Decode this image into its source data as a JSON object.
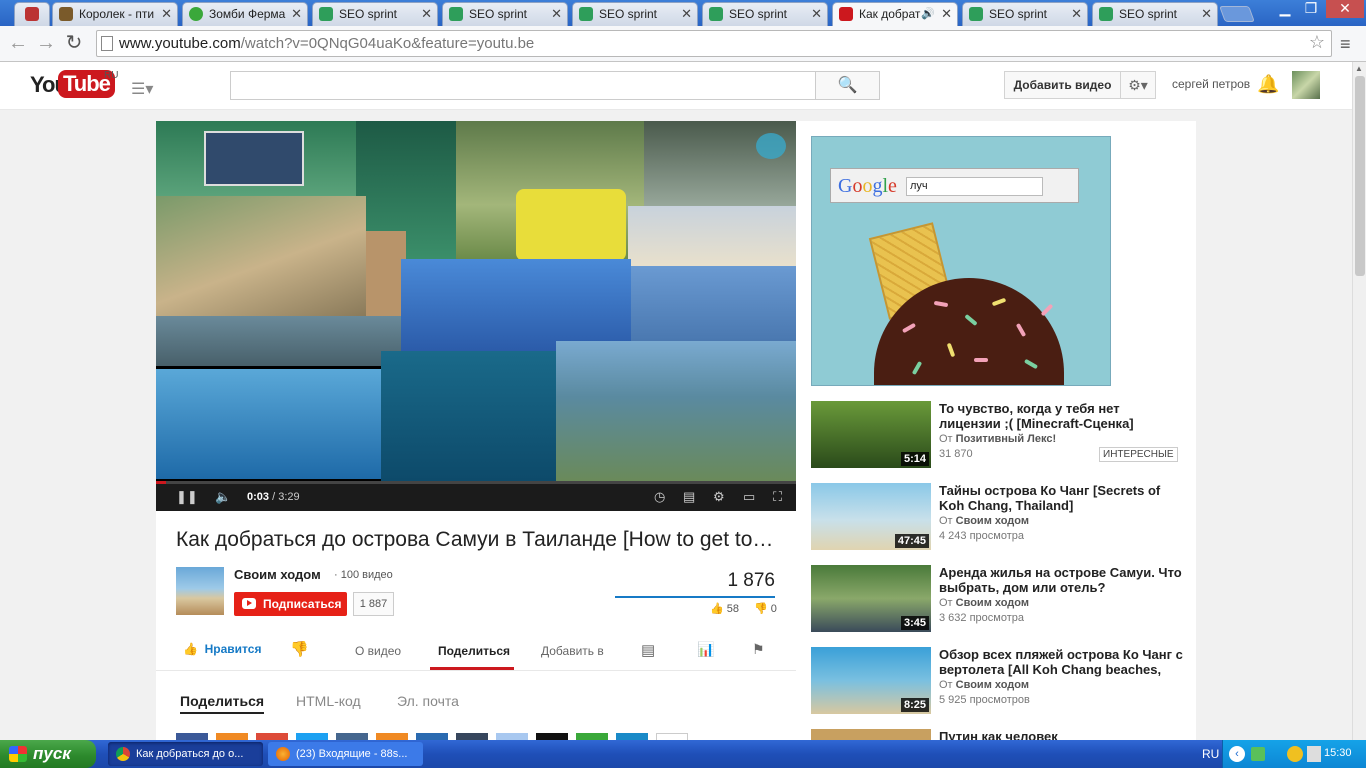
{
  "browser": {
    "tabs": [
      {
        "label": "Королек - пти",
        "color": "#7a5a2a"
      },
      {
        "label": "Зомби Ферма",
        "color": "#3aa83a"
      },
      {
        "label": "SEO sprint",
        "color": "#2e9e5a"
      },
      {
        "label": "SEO sprint",
        "color": "#2e9e5a"
      },
      {
        "label": "SEO sprint",
        "color": "#2e9e5a"
      },
      {
        "label": "SEO sprint",
        "color": "#2e9e5a"
      },
      {
        "label": "Как добрат",
        "color": "#cc181e"
      },
      {
        "label": "SEO sprint",
        "color": "#2e9e5a"
      },
      {
        "label": "SEO sprint",
        "color": "#2e9e5a"
      }
    ],
    "url_host": "www.youtube.com",
    "url_path": "/watch?v=0QNqG04uaKo&feature=youtu.be"
  },
  "header": {
    "logo_you": "You",
    "logo_tube": "Tube",
    "logo_region": "RU",
    "search_placeholder": "",
    "upload_label": "Добавить видео",
    "username": "сергей петров"
  },
  "player": {
    "current_time": "0:03",
    "duration": "/ 3:29",
    "progress_fraction": 0.015
  },
  "video": {
    "title": "Как добраться до острова Самуи в Таиланде [How to get to Samui island, Thailand]",
    "channel_name": "Своим ходом",
    "channel_video_count": "· 100 видео",
    "subscribe_label": "Подписаться",
    "subscriber_count": "1 887",
    "views": "1 876",
    "likes": "58",
    "dislikes": "0"
  },
  "actions": {
    "like_label": "Нравится",
    "about_label": "О видео",
    "share_label": "Поделиться",
    "add_to_label": "Добавить в"
  },
  "share_tabs": {
    "share": "Поделиться",
    "embed": "HTML-код",
    "email": "Эл. почта"
  },
  "ad": {
    "google_logo": "Google",
    "search_text": "луч"
  },
  "recommendations": [
    {
      "title": "То чувство, когда у тебя нет лицензии ;( [Minecraft-Сценка]",
      "by_prefix": "От ",
      "channel": "Позитивный Лекс!",
      "views": "31 870",
      "badge": "ИНТЕРЕСНЫЕ",
      "duration": "5:14"
    },
    {
      "title": "Тайны острова Ко Чанг [Secrets of Koh Chang, Thailand]",
      "by_prefix": "От ",
      "channel": "Своим ходом",
      "views": "4 243 просмотра",
      "duration": "47:45"
    },
    {
      "title": "Аренда жилья на острове Самуи. Что выбрать, дом или отель?",
      "by_prefix": "От ",
      "channel": "Своим ходом",
      "views": "3 632 просмотра",
      "duration": "3:45"
    },
    {
      "title": "Обзор всех пляжей острова Ко Чанг с вертолета [All Koh Chang beaches,",
      "by_prefix": "От ",
      "channel": "Своим ходом",
      "views": "5 925 просмотров",
      "duration": "8:25"
    },
    {
      "title": "Путин как человек"
    }
  ],
  "taskbar": {
    "start_label": "пуск",
    "tasks": [
      {
        "label": "Как добраться до о..."
      },
      {
        "label": "(23) Входящие - 88s..."
      }
    ],
    "language": "RU",
    "clock": "15:30"
  },
  "colors": {
    "youtube_red": "#cc181e",
    "link_blue": "#167ac6",
    "taskbar_blue": "#245edb",
    "start_green": "#3c9a3c"
  }
}
